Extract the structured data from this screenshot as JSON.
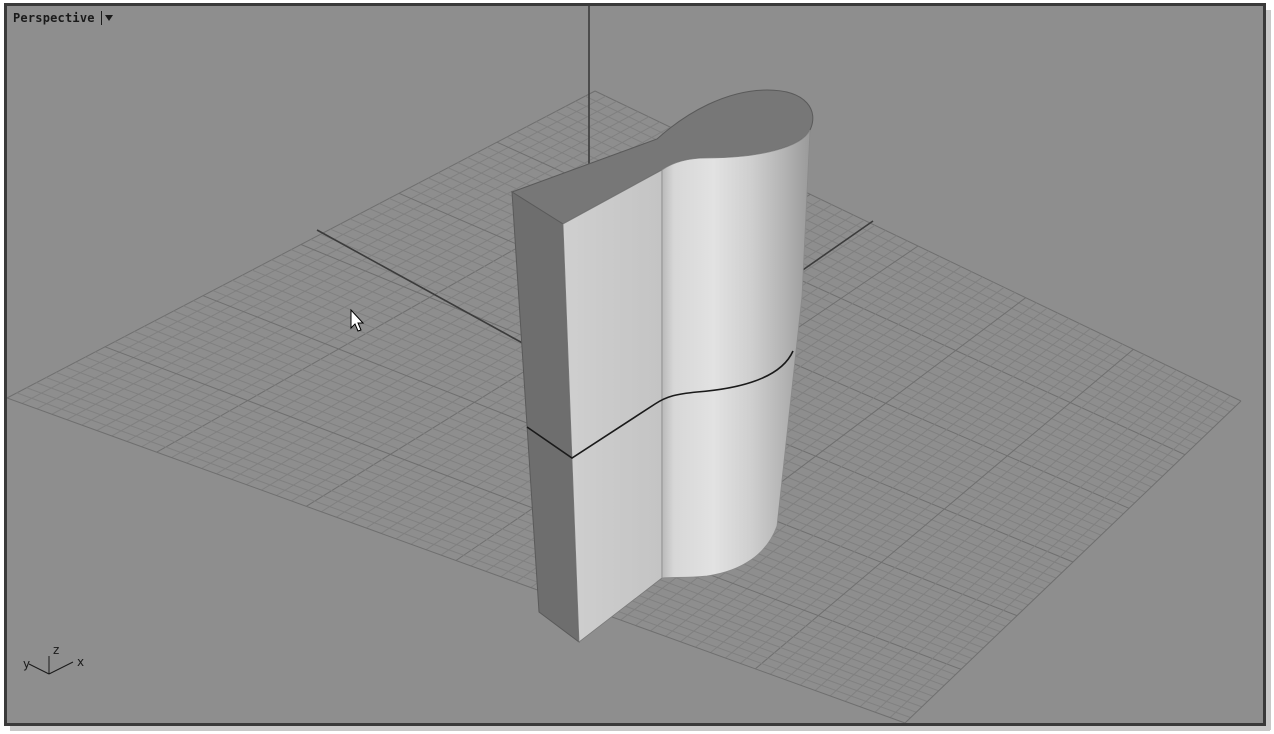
{
  "viewport": {
    "title": "Perspective",
    "menu_icon": "dropdown-arrow-icon"
  },
  "axes": {
    "x_label": "x",
    "y_label": "y",
    "z_label": "z"
  },
  "colors": {
    "background": "#8e8e8e",
    "grid_minor": "#7f7f7f",
    "grid_major": "#3c3c3c",
    "frame": "#3a3a3a"
  }
}
